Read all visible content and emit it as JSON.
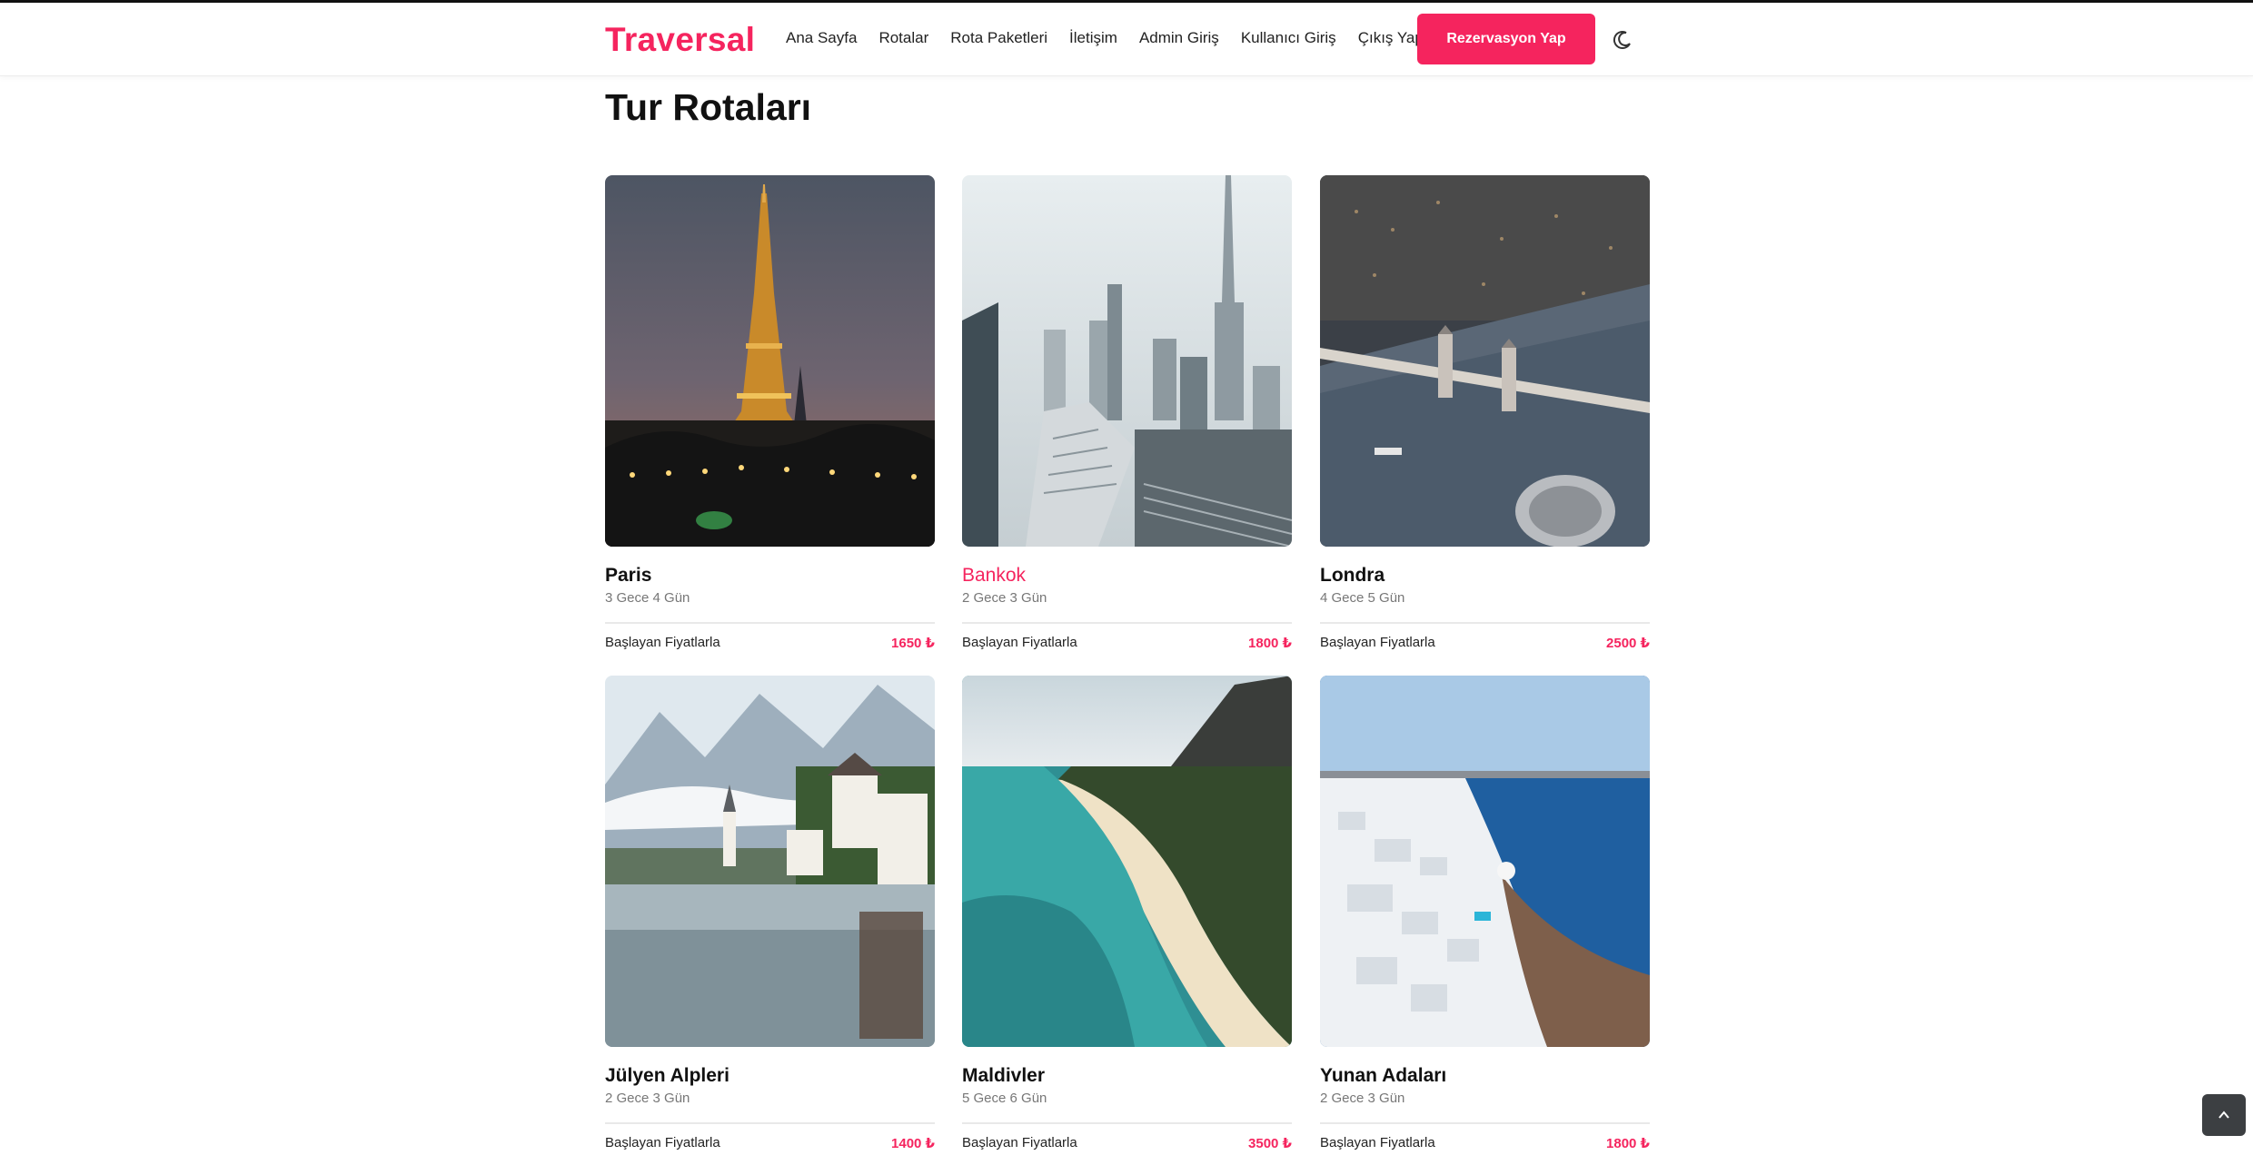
{
  "header": {
    "brand": "Traversal",
    "nav": [
      "Ana Sayfa",
      "Rotalar",
      "Rota Paketleri",
      "İletişim",
      "Admin Giriş",
      "Kullanıcı Giriş",
      "Çıkış Yap"
    ],
    "cta": "Rezervasyon Yap",
    "theme_icon": "moon-icon"
  },
  "page": {
    "title": "Tur Rotaları"
  },
  "cards": [
    {
      "name": "Paris",
      "duration": "3 Gece 4 Gün",
      "price_label": "Başlayan Fiyatlarla",
      "price": "1650 ₺",
      "image": "eiffel-tower-at-dusk"
    },
    {
      "name": "Bankok",
      "duration": "2 Gece 3 Gün",
      "price_label": "Başlayan Fiyatlarla",
      "price": "1800 ₺",
      "image": "city-skyline"
    },
    {
      "name": "Londra",
      "duration": "4 Gece 5 Gün",
      "price_label": "Başlayan Fiyatlarla",
      "price": "2500 ₺",
      "image": "tower-bridge-aerial"
    },
    {
      "name": "Jülyen Alpleri",
      "duration": "2 Gece 3 Gün",
      "price_label": "Başlayan Fiyatlarla",
      "price": "1400 ₺",
      "image": "alpine-lake-village"
    },
    {
      "name": "Maldivler",
      "duration": "5 Gece 6 Gün",
      "price_label": "Başlayan Fiyatlarla",
      "price": "3500 ₺",
      "image": "tropical-beach-aerial"
    },
    {
      "name": "Yunan Adaları",
      "duration": "2 Gece 3 Gün",
      "price_label": "Başlayan Fiyatlarla",
      "price": "1800 ₺",
      "image": "santorini-cliffs"
    }
  ],
  "colors": {
    "accent": "#f5245e",
    "text": "#111111",
    "muted": "#777777",
    "scroll_button": "#3c3f42"
  },
  "scroll_top_icon": "chevron-up-icon"
}
